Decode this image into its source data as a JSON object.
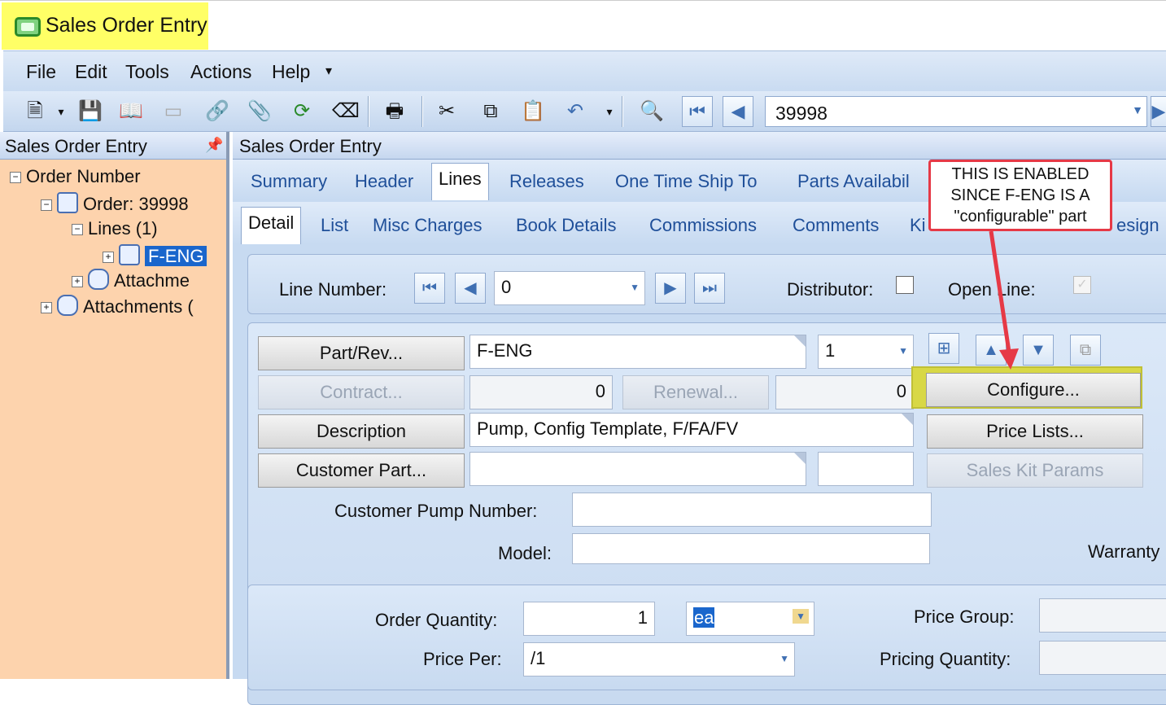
{
  "window": {
    "title": "Sales Order Entry"
  },
  "menu": {
    "items": [
      "File",
      "Edit",
      "Tools",
      "Actions",
      "Help"
    ]
  },
  "toolbar": {
    "record_value": "39998"
  },
  "left_panel": {
    "title": "Sales Order Entry",
    "tree": {
      "root": "Order Number",
      "order": "Order: 39998",
      "lines": "Lines (1)",
      "part": "F-ENG",
      "attachments_line": "Attachme",
      "attachments_order": "Attachments ("
    }
  },
  "main": {
    "title": "Sales Order Entry",
    "tabs": [
      "Summary",
      "Header",
      "Lines",
      "Releases",
      "One Time Ship To",
      "Parts Availabil"
    ],
    "subtabs": [
      "Detail",
      "List",
      "Misc Charges",
      "Book Details",
      "Commissions",
      "Comments",
      "Ki",
      "esign"
    ],
    "line_nav": {
      "label": "Line Number:",
      "value": "0",
      "distributor_label": "Distributor:",
      "open_line_label": "Open Line:"
    },
    "part": {
      "part_button": "Part/Rev...",
      "part_value": "F-ENG",
      "rev_value": "1",
      "contract_button": "Contract...",
      "contract_value": "0",
      "renewal_button": "Renewal...",
      "renewal_value": "0",
      "configure_button": "Configure...",
      "description_button": "Description",
      "description_value": "Pump, Config Template, F/FA/FV",
      "price_lists_button": "Price Lists...",
      "customer_part_button": "Customer Part...",
      "sales_kit_button": "Sales Kit Params",
      "customer_pump_label": "Customer Pump Number:",
      "model_label": "Model:",
      "warranty_label": "Warranty"
    },
    "quantity": {
      "order_qty_label": "Order Quantity:",
      "order_qty_value": "1",
      "uom_value": "ea",
      "price_group_label": "Price Group:",
      "price_per_label": "Price Per:",
      "price_per_value": "/1",
      "pricing_qty_label": "Pricing Quantity:"
    }
  },
  "annotation": {
    "line1": "THIS IS ENABLED",
    "line2": "SINCE F-ENG IS A",
    "line3": "\"configurable\" part"
  },
  "colors": {
    "callout_border": "#e63946",
    "highlight": "#d8d846",
    "title_highlight": "#ffff66",
    "tree_panel": "#fdd3ad"
  }
}
